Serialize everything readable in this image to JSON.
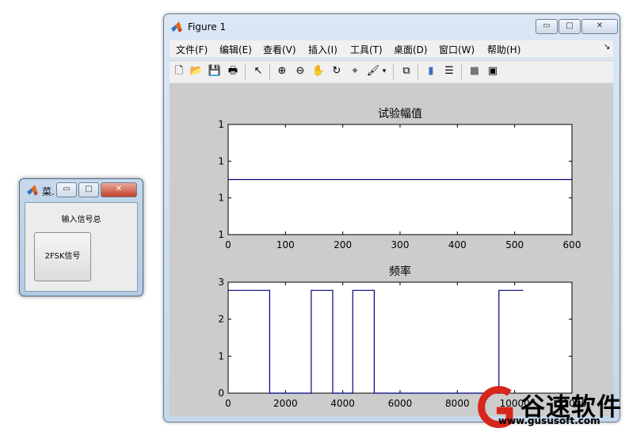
{
  "menu_window": {
    "title": "菜.",
    "label": "输入信号总",
    "button_label": "2FSK信号",
    "min_glyph": "▭",
    "max_glyph": "□",
    "close_glyph": "✕"
  },
  "figure_window": {
    "title": "Figure 1",
    "min_glyph": "▭",
    "max_glyph": "□",
    "close_glyph": "✕",
    "menus": [
      "文件(F)",
      "编辑(E)",
      "查看(V)",
      "插入(I)",
      "工具(T)",
      "桌面(D)",
      "窗口(W)",
      "帮助(H)"
    ],
    "menu_arrow": "↘",
    "toolbar_icons": [
      {
        "name": "new-figure-icon",
        "glyph": "🗋"
      },
      {
        "name": "open-file-icon",
        "glyph": "📂"
      },
      {
        "name": "save-icon",
        "glyph": "💾"
      },
      {
        "name": "print-icon",
        "glyph": "🖶"
      },
      {
        "name": "select-arrow-icon",
        "glyph": "↖"
      },
      {
        "name": "zoom-in-icon",
        "glyph": "⊕"
      },
      {
        "name": "zoom-out-icon",
        "glyph": "⊖"
      },
      {
        "name": "pan-hand-icon",
        "glyph": "✋"
      },
      {
        "name": "rotate-3d-icon",
        "glyph": "↻"
      },
      {
        "name": "data-cursor-icon",
        "glyph": "⌖"
      },
      {
        "name": "brush-icon",
        "glyph": "🖌"
      },
      {
        "name": "brush-dropdown-icon",
        "glyph": "▾"
      },
      {
        "name": "link-plot-icon",
        "glyph": "⧉"
      },
      {
        "name": "colorbar-icon",
        "glyph": "▮"
      },
      {
        "name": "legend-icon",
        "glyph": "☰"
      },
      {
        "name": "hide-plot-tools-icon",
        "glyph": "■"
      },
      {
        "name": "show-plot-tools-icon",
        "glyph": "▣"
      }
    ]
  },
  "colors": {
    "plot_line": "#00007f",
    "canvas_bg": "#cccccc",
    "watermark_red": "#d8261d"
  },
  "chart_data": [
    {
      "type": "line",
      "title": "试验幅值",
      "xlabel": "",
      "ylabel": "",
      "xlim": [
        0,
        600
      ],
      "ylim": [
        0.7,
        1.3
      ],
      "x_ticks": [
        0,
        100,
        200,
        300,
        400,
        500,
        600
      ],
      "y_tick_values": [
        0.7,
        0.9,
        1.1,
        1.3
      ],
      "y_tick_labels": [
        "1",
        "1",
        "1",
        "1"
      ],
      "series": [
        {
          "x": [
            0,
            600
          ],
          "y": [
            1,
            1
          ]
        }
      ]
    },
    {
      "type": "line",
      "title": "频率",
      "xlabel": "",
      "ylabel": "",
      "xlim": [
        0,
        12000
      ],
      "ylim": [
        0,
        3
      ],
      "x_ticks": [
        0,
        2000,
        4000,
        6000,
        8000,
        10000,
        12000
      ],
      "y_ticks": [
        0,
        1,
        2,
        3
      ],
      "series": [
        {
          "x": [
            0,
            1450,
            1450,
            2900,
            2900,
            3650,
            3650,
            4350,
            4350,
            5100,
            5100,
            9450,
            9450,
            10300
          ],
          "y": [
            2.78,
            2.78,
            0,
            0,
            2.78,
            2.78,
            0,
            0,
            2.78,
            2.78,
            0,
            0,
            2.78,
            2.78
          ]
        }
      ]
    }
  ],
  "watermark": {
    "brand": "谷速软件",
    "url": "www.gususoft.com"
  }
}
